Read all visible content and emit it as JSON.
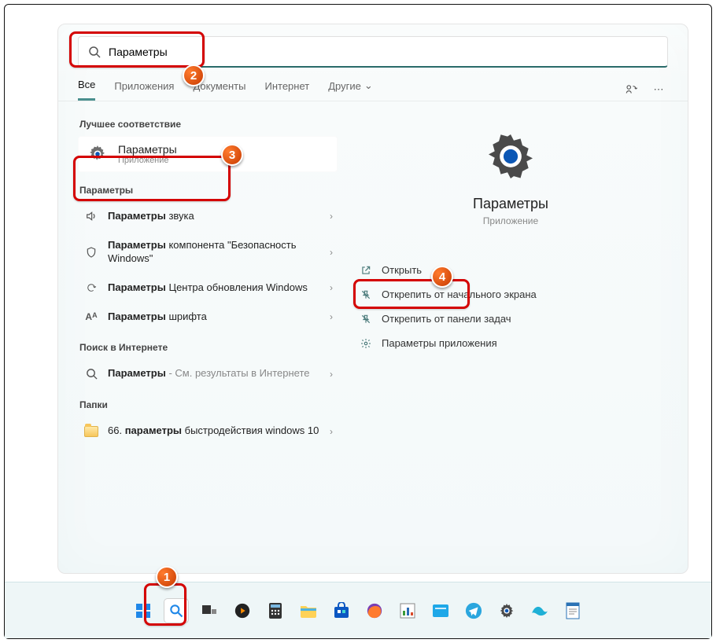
{
  "search": {
    "value": "Параметры"
  },
  "tabs": {
    "all": "Все",
    "apps": "Приложения",
    "docs": "Документы",
    "web": "Интернет",
    "more": "Другие"
  },
  "left": {
    "best_title": "Лучшее соответствие",
    "best": {
      "title": "Параметры",
      "sub": "Приложение"
    },
    "params_title": "Параметры",
    "i_sound_b": "Параметры",
    "i_sound_r": " звука",
    "i_sec_b": "Параметры",
    "i_sec_r": " компонента \"Безопасность Windows\"",
    "i_upd_b": "Параметры",
    "i_upd_r": " Центра обновления Windows",
    "i_font_b": "Параметры",
    "i_font_r": " шрифта",
    "web_title": "Поиск в Интернете",
    "i_web_b": "Параметры",
    "i_web_r": " - См. результаты в Интернете",
    "folders_title": "Папки",
    "i_folder_pre": "66. ",
    "i_folder_b": "параметры",
    "i_folder_r": " быстродействия windows 10"
  },
  "preview": {
    "name": "Параметры",
    "type": "Приложение"
  },
  "actions": {
    "open": "Открыть",
    "unpin_start": "Открепить от начального экрана",
    "unpin_task": "Открепить от панели задач",
    "app_params": "Параметры приложения"
  },
  "markers": {
    "m1": "1",
    "m2": "2",
    "m3": "3",
    "m4": "4"
  }
}
